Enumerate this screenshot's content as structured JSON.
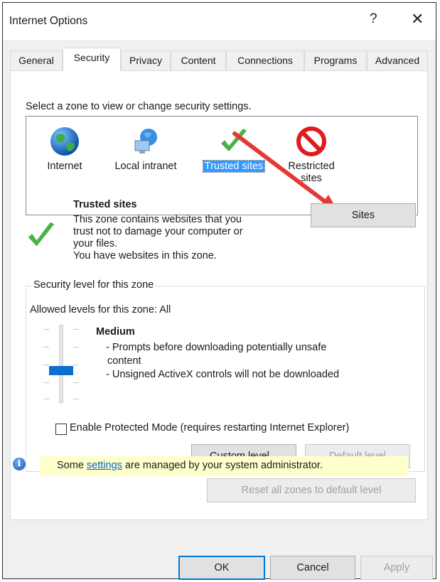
{
  "window": {
    "title": "Internet Options",
    "help_glyph": "?",
    "close_glyph": "✕"
  },
  "tabs": [
    {
      "label": "General"
    },
    {
      "label": "Security"
    },
    {
      "label": "Privacy"
    },
    {
      "label": "Content"
    },
    {
      "label": "Connections"
    },
    {
      "label": "Programs"
    },
    {
      "label": "Advanced"
    }
  ],
  "active_tab": "Security",
  "security": {
    "zone_prompt": "Select a zone to view or change security settings.",
    "zones": [
      {
        "label": "Internet",
        "icon": "globe-icon"
      },
      {
        "label": "Local intranet",
        "icon": "intranet-icon"
      },
      {
        "label": "Trusted sites",
        "icon": "checkmark-icon",
        "selected": true
      },
      {
        "label_line1": "Restricted",
        "label_line2": "sites",
        "icon": "restricted-icon"
      }
    ],
    "zone_detail": {
      "title": "Trusted sites",
      "desc_line1": "This zone contains websites that you",
      "desc_line2": "trust not to damage your computer or",
      "desc_line3": "your files.",
      "desc_line4": "You have websites in this zone."
    },
    "sites_button": "Sites",
    "level_group": {
      "legend": "Security level for this zone",
      "allowed": "Allowed levels for this zone: All",
      "level_name": "Medium",
      "bullet1_line1": "- Prompts before downloading potentially unsafe",
      "bullet1_line2": "content",
      "bullet2": "- Unsigned ActiveX controls will not be downloaded",
      "protected_mode_label": "Enable Protected Mode (requires restarting Internet Explorer)",
      "protected_mode_checked": false,
      "custom_level_button": "Custom level...",
      "default_level_button": "Default level"
    },
    "reset_button": "Reset all zones to default level",
    "info_before": "Some ",
    "info_link": "settings",
    "info_after": " are managed by your system administrator."
  },
  "buttons": {
    "ok": "OK",
    "cancel": "Cancel",
    "apply": "Apply"
  },
  "colors": {
    "selection": "#3399ff",
    "accent": "#0078d7",
    "annotation_arrow": "#e53935",
    "info_bar": "#ffffcc"
  }
}
